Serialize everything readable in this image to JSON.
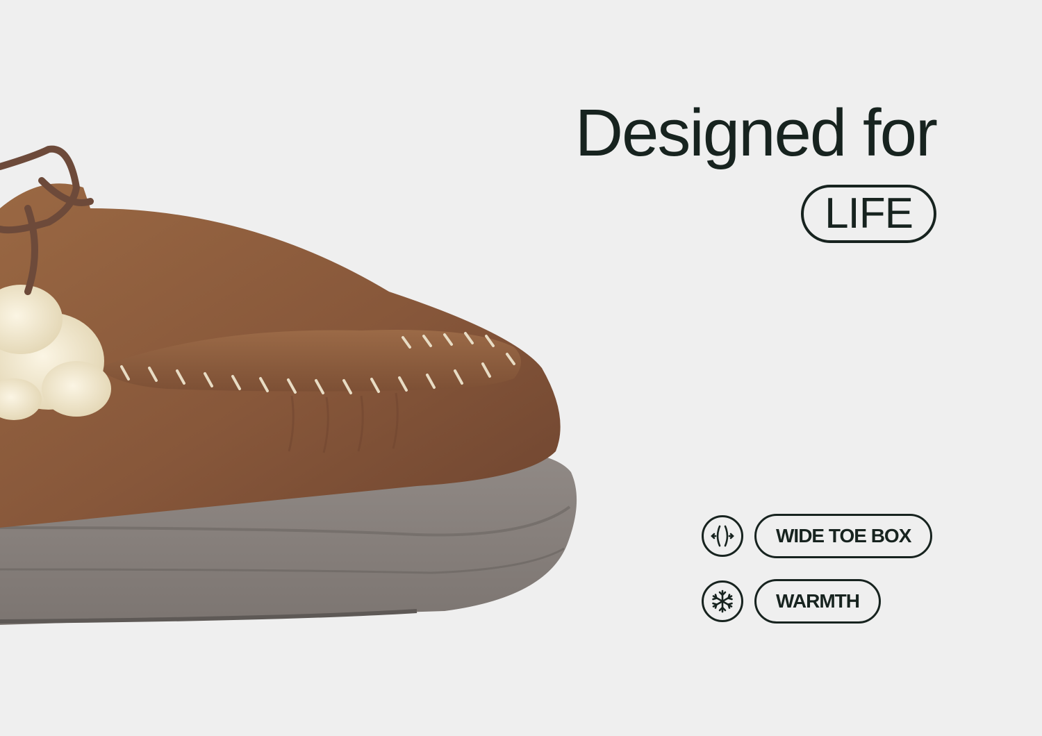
{
  "headline": {
    "line1": "Designed for",
    "highlight": "LIFE"
  },
  "features": [
    {
      "icon": "wide-toe-box-icon",
      "label": "WIDE TOE BOX"
    },
    {
      "icon": "snowflake-icon",
      "label": "WARMTH"
    }
  ],
  "colors": {
    "background": "#efefef",
    "text": "#17231f",
    "suede": "#8a5a39",
    "sole": "#8c8581",
    "shearling": "#efe6cf"
  }
}
